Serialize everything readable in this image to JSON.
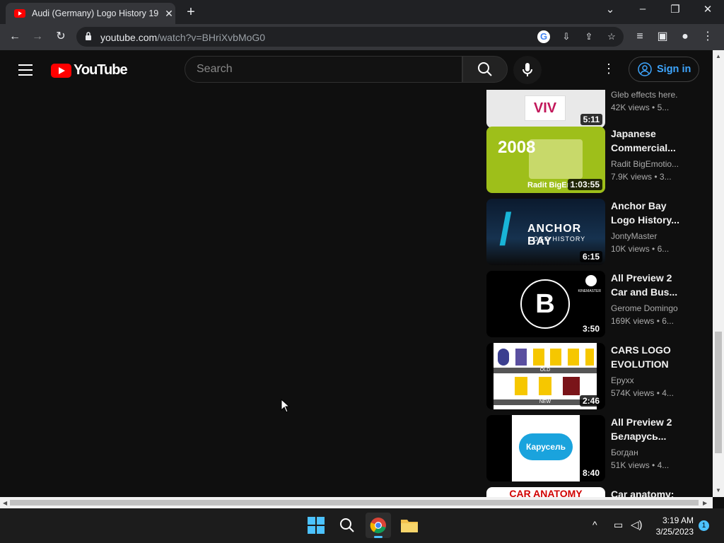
{
  "browser": {
    "tab_title": "Audi (Germany) Logo History 19",
    "url_host": "youtube.com",
    "url_path": "/watch?v=BHriXvbMoG0"
  },
  "youtube": {
    "logo_text": "YouTube",
    "search_placeholder": "Search",
    "signin_label": "Sign in"
  },
  "videos": [
    {
      "title": "",
      "channel": "Gleb effects here.",
      "views": "42K views",
      "age": "5...",
      "duration": "5:11",
      "thumb_text": "VIV"
    },
    {
      "title": "Japanese Commercial...",
      "channel": "Radit BigEmotio...",
      "views": "7.9K views",
      "age": "3...",
      "duration": "1:03:55",
      "thumb_text": "2008",
      "thumb_caption": "Radit BigEn"
    },
    {
      "title": "Anchor Bay Logo History...",
      "channel": "JontyMaster",
      "views": "10K views",
      "age": "6...",
      "duration": "6:15",
      "thumb_text": "ANCHOR BAY",
      "thumb_sub": "LOGO HISTORY"
    },
    {
      "title": "All Preview 2 Car and Bus...",
      "channel": "Gerome Domingo",
      "views": "169K views",
      "age": "6...",
      "duration": "3:50",
      "thumb_text": "KINEMASTER"
    },
    {
      "title": "CARS LOGO EVOLUTION",
      "channel": "Epyxx",
      "views": "574K views",
      "age": "4...",
      "duration": "2:46",
      "thumb_text": "OLD",
      "thumb_sub": "NEW"
    },
    {
      "title": "All Preview 2 Беларусь...",
      "channel": "Богдан",
      "views": "51K views",
      "age": "4...",
      "duration": "8:40",
      "thumb_text": "Карусель"
    },
    {
      "title": "Car anatomy:",
      "channel": "",
      "views": "",
      "age": "",
      "duration": "",
      "thumb_text": "CAR ANATOMY"
    }
  ],
  "taskbar": {
    "time": "3:19 AM",
    "date": "3/25/2023",
    "notifications": "1"
  }
}
